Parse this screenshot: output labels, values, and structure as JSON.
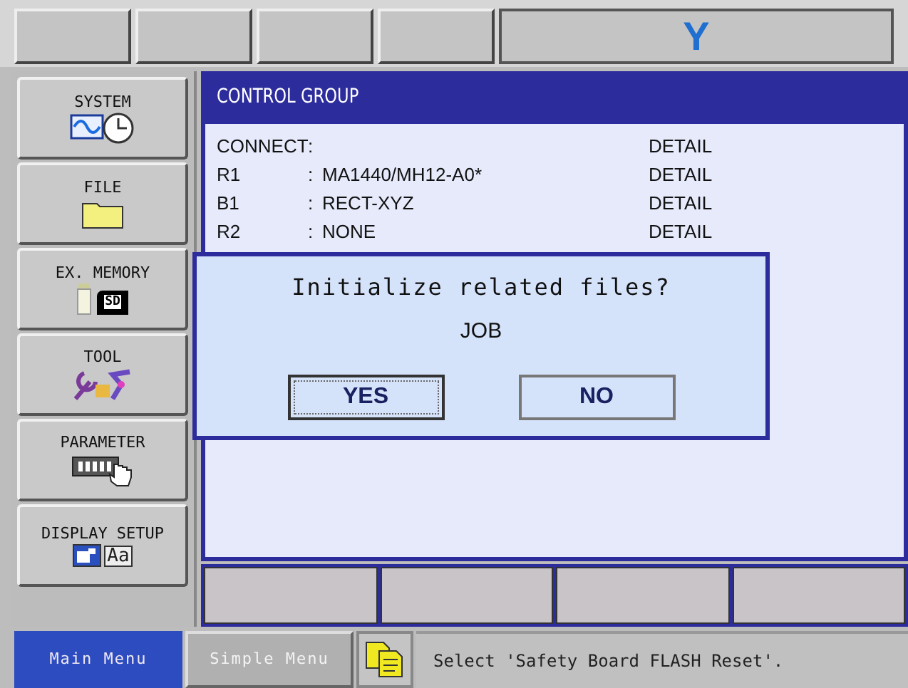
{
  "header": {
    "logo": "Y"
  },
  "menu": [
    {
      "label": "SYSTEM",
      "kind": "system"
    },
    {
      "label": "FILE",
      "kind": "file"
    },
    {
      "label": "EX. MEMORY",
      "kind": "memory",
      "icon_text": "SD"
    },
    {
      "label": "TOOL",
      "kind": "tool"
    },
    {
      "label": "PARAMETER",
      "kind": "parameter"
    },
    {
      "label": "DISPLAY SETUP",
      "kind": "display",
      "icon_text": "Aa"
    }
  ],
  "panel": {
    "title": "CONTROL GROUP",
    "rows": [
      {
        "name": "CONNECT",
        "separator": ":",
        "value": "",
        "action": "DETAIL"
      },
      {
        "name": "R1",
        "separator": ":",
        "value": "MA1440/MH12-A0*",
        "action": "DETAIL"
      },
      {
        "name": "B1",
        "separator": ":",
        "value": "RECT-XYZ",
        "action": "DETAIL"
      },
      {
        "name": "R2",
        "separator": ":",
        "value": "NONE",
        "action": "DETAIL"
      }
    ]
  },
  "dialog": {
    "message": "Initialize related files?",
    "detail": "JOB",
    "buttons": [
      {
        "label": "YES",
        "selected": true
      },
      {
        "label": "NO",
        "selected": false
      }
    ]
  },
  "bottom_tabs": [
    {
      "label": "Main Menu",
      "selected": true
    },
    {
      "label": "Simple Menu",
      "selected": false
    }
  ],
  "status_message": "Select 'Safety Board FLASH Reset'."
}
